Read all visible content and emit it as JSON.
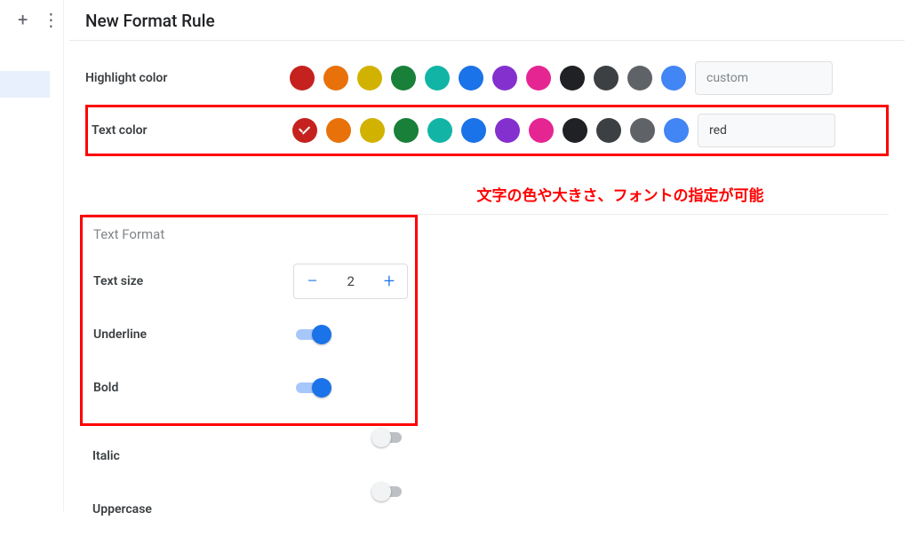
{
  "page": {
    "title": "New Format Rule"
  },
  "palette": [
    "#c5221f",
    "#e8710a",
    "#d2b200",
    "#188038",
    "#12b5a5",
    "#1a73e8",
    "#8430ce",
    "#e52592",
    "#202124",
    "#3c4043",
    "#5f6368",
    "#4285f4"
  ],
  "highlight": {
    "label": "Highlight color",
    "custom_label": "custom"
  },
  "textcolor": {
    "label": "Text color",
    "custom_label": "red",
    "selected_index": 0
  },
  "annotation": "文字の色や大きさ、フォントの指定が可能",
  "format": {
    "section_title": "Text Format",
    "text_size": {
      "label": "Text size",
      "value": "2"
    },
    "underline": {
      "label": "Underline",
      "on": true
    },
    "bold": {
      "label": "Bold",
      "on": true
    },
    "italic": {
      "label": "Italic",
      "on": false
    },
    "uppercase": {
      "label": "Uppercase",
      "on": false
    }
  }
}
